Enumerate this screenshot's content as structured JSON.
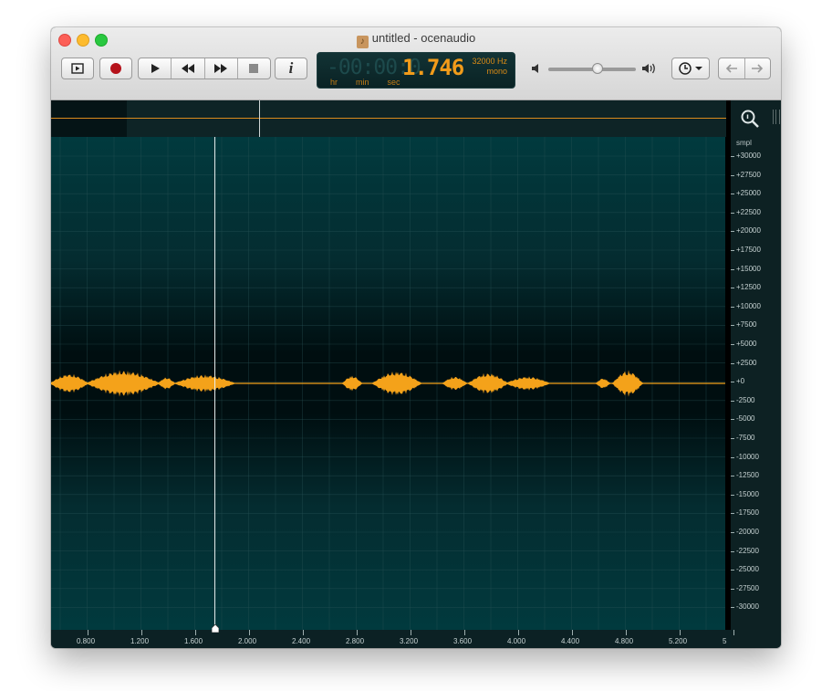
{
  "window": {
    "title": "untitled - ocenaudio",
    "doc_icon": "music-note-icon"
  },
  "toolbar": {
    "show_selection_icon": "play-selection-icon",
    "record_icon": "record-icon",
    "play_icon": "play-icon",
    "rewind_icon": "rewind-icon",
    "forward_icon": "fast-forward-icon",
    "stop_icon": "stop-icon",
    "info_label": "i",
    "history_icon": "clock-icon",
    "back_icon": "arrow-left-icon",
    "forward_nav_icon": "arrow-right-icon"
  },
  "display": {
    "dim_digits": "-00:00:0",
    "time_value": "1.746",
    "sample_rate": "32000 Hz",
    "channels": "mono",
    "unit_hr": "hr",
    "unit_min": "min",
    "unit_sec": "sec"
  },
  "volume": {
    "level": 0.56
  },
  "vertical_axis": {
    "unit": "smpl",
    "ticks": [
      "+30000",
      "+27500",
      "+25000",
      "+22500",
      "+20000",
      "+17500",
      "+15000",
      "+12500",
      "+10000",
      "+7500",
      "+5000",
      "+2500",
      "+0",
      "-2500",
      "-5000",
      "-7500",
      "-10000",
      "-12500",
      "-15000",
      "-17500",
      "-20000",
      "-22500",
      "-25000",
      "-27500",
      "-30000"
    ]
  },
  "time_axis": {
    "ticks": [
      "0.800",
      "1.200",
      "1.600",
      "2.000",
      "2.400",
      "2.800",
      "3.200",
      "3.600",
      "4.000",
      "4.400",
      "4.800",
      "5.200",
      "5"
    ]
  },
  "cursor_time_sec": 1.746,
  "colors": {
    "waveform": "#f4a21a",
    "lcd_text": "#f19b1a",
    "canvas": "#013a3e",
    "grid": "#2b5558"
  }
}
